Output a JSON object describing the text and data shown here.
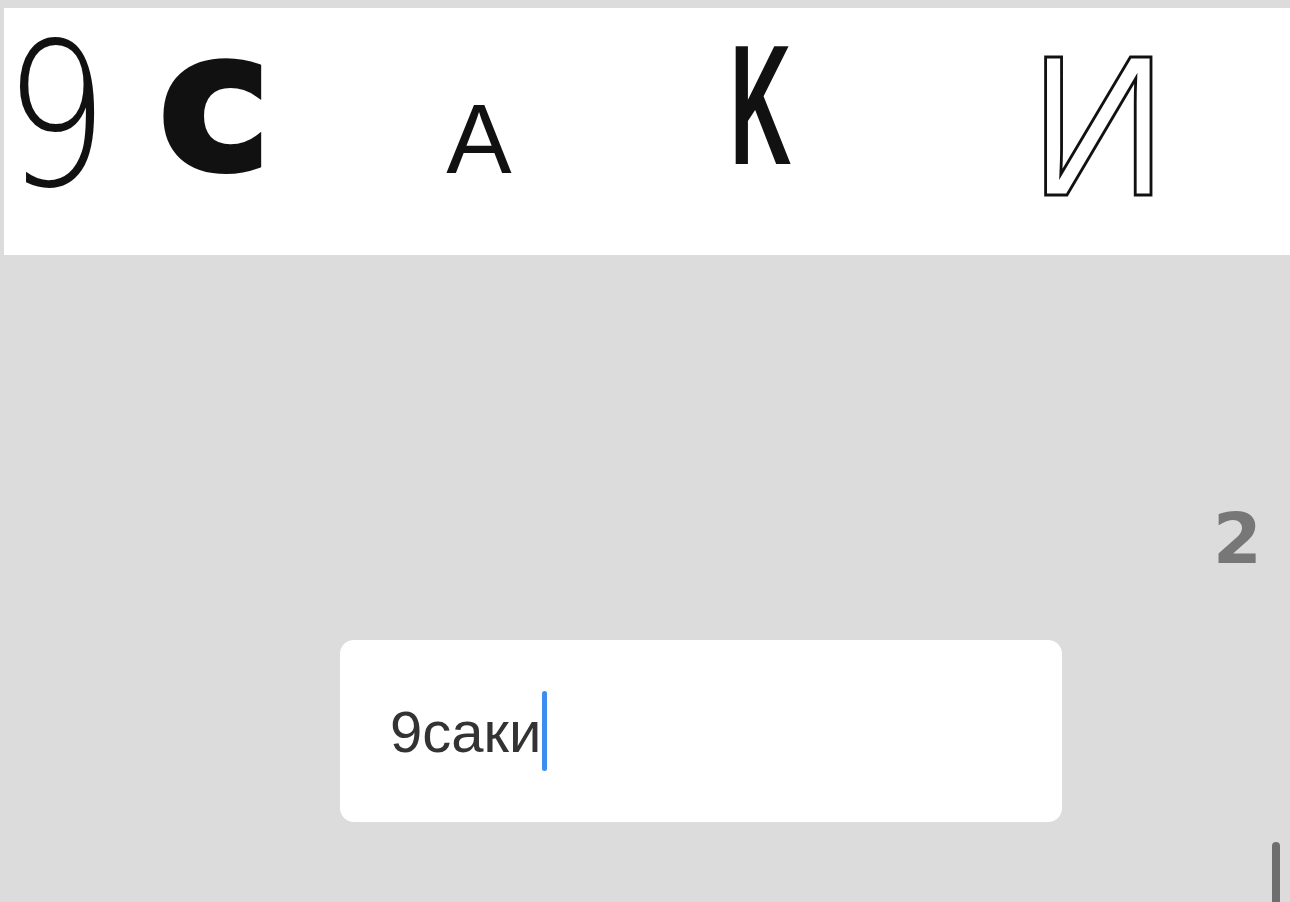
{
  "captcha": {
    "glyphs": [
      {
        "char": "9",
        "kind": "thin"
      },
      {
        "char": "c",
        "kind": "heavy"
      },
      {
        "char": "A",
        "kind": "small"
      },
      {
        "char": "K",
        "kind": "condensed"
      },
      {
        "char": "И",
        "kind": "outline"
      }
    ]
  },
  "counter": "2",
  "answer": {
    "value": "9саки",
    "focused": true
  }
}
